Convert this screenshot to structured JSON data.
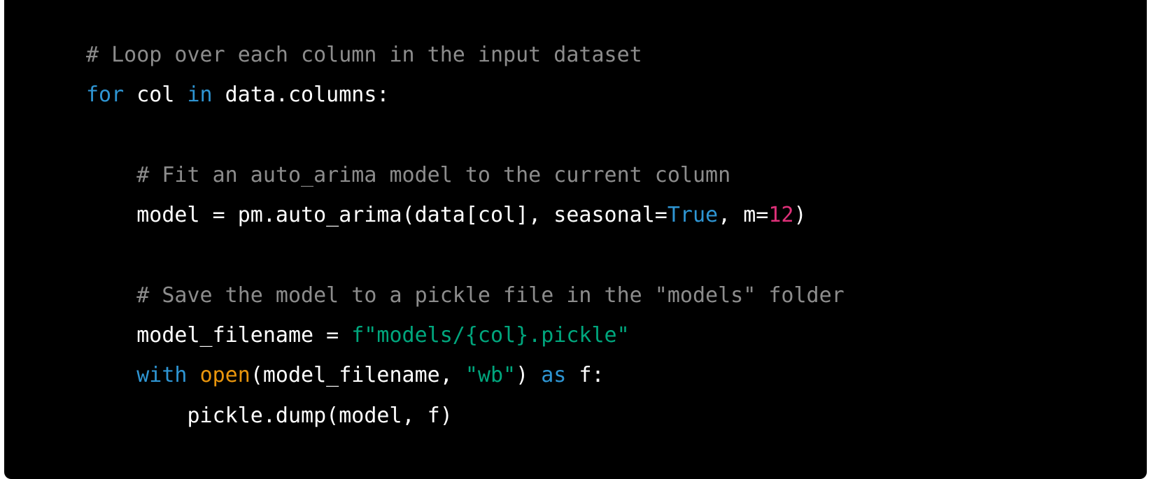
{
  "code": {
    "language": "python",
    "colors": {
      "background": "#000000",
      "plain": "#ffffff",
      "comment": "#8c8c8c",
      "keyword": "#2e95d3",
      "number": "#df3079",
      "string": "#00a67d",
      "builtin": "#e9950c"
    },
    "lines": [
      [
        {
          "t": "# Loop over each column in the input dataset",
          "c": "comment"
        }
      ],
      [
        {
          "t": "for",
          "c": "keyword"
        },
        {
          "t": " col ",
          "c": "plain"
        },
        {
          "t": "in",
          "c": "keyword"
        },
        {
          "t": " data.columns:",
          "c": "plain"
        }
      ],
      [],
      [
        {
          "t": "    # Fit an auto_arima model to the current column",
          "c": "comment"
        }
      ],
      [
        {
          "t": "    model = pm.auto_arima(data[col], seasonal=",
          "c": "plain"
        },
        {
          "t": "True",
          "c": "keyword"
        },
        {
          "t": ", m=",
          "c": "plain"
        },
        {
          "t": "12",
          "c": "number"
        },
        {
          "t": ")",
          "c": "plain"
        }
      ],
      [],
      [
        {
          "t": "    # Save the model to a pickle file in the \"models\" folder",
          "c": "comment"
        }
      ],
      [
        {
          "t": "    model_filename = ",
          "c": "plain"
        },
        {
          "t": "f\"models/{col}.pickle\"",
          "c": "string"
        }
      ],
      [
        {
          "t": "    ",
          "c": "plain"
        },
        {
          "t": "with",
          "c": "keyword"
        },
        {
          "t": " ",
          "c": "plain"
        },
        {
          "t": "open",
          "c": "builtin"
        },
        {
          "t": "(model_filename, ",
          "c": "plain"
        },
        {
          "t": "\"wb\"",
          "c": "string"
        },
        {
          "t": ") ",
          "c": "plain"
        },
        {
          "t": "as",
          "c": "keyword"
        },
        {
          "t": " f:",
          "c": "plain"
        }
      ],
      [
        {
          "t": "        pickle.dump(model, f)",
          "c": "plain"
        }
      ]
    ]
  }
}
